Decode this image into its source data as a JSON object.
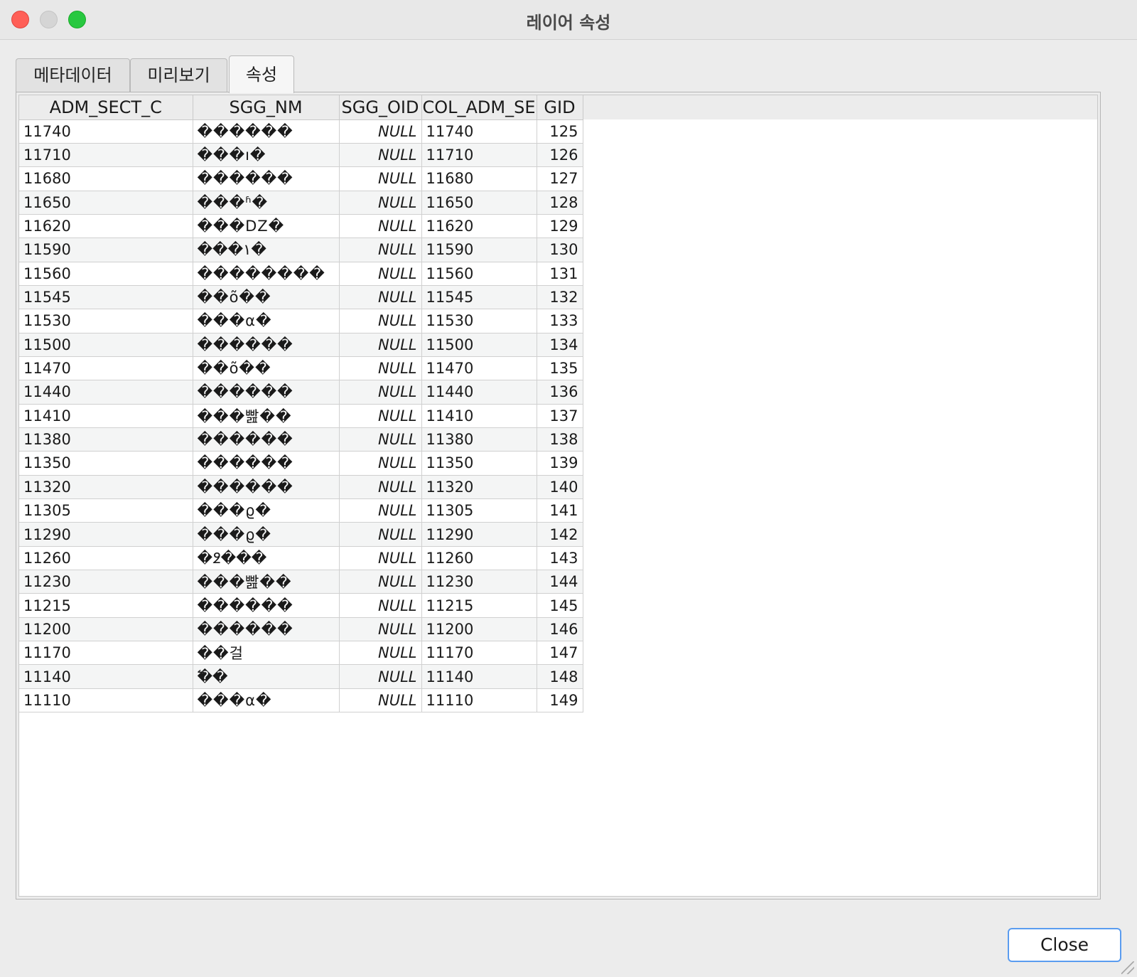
{
  "window": {
    "title": "레이어 속성"
  },
  "tabs": [
    {
      "label": "메타데이터",
      "active": false
    },
    {
      "label": "미리보기",
      "active": false
    },
    {
      "label": "속성",
      "active": true
    }
  ],
  "table": {
    "columns": [
      "ADM_SECT_C",
      "SGG_NM",
      "SGG_OID",
      "COL_ADM_SE",
      "GID"
    ],
    "rows": [
      [
        "11740",
        "������",
        "NULL",
        "11740",
        "125"
      ],
      [
        "11710",
        "���ı�",
        "NULL",
        "11710",
        "126"
      ],
      [
        "11680",
        "������",
        "NULL",
        "11680",
        "127"
      ],
      [
        "11650",
        "���ʱ�",
        "NULL",
        "11650",
        "128"
      ],
      [
        "11620",
        "���DZ�",
        "NULL",
        "11620",
        "129"
      ],
      [
        "11590",
        "���۱�",
        "NULL",
        "11590",
        "130"
      ],
      [
        "11560",
        "��������",
        "NULL",
        "11560",
        "131"
      ],
      [
        "11545",
        "��õ��",
        "NULL",
        "11545",
        "132"
      ],
      [
        "11530",
        "���α�",
        "NULL",
        "11530",
        "133"
      ],
      [
        "11500",
        "������",
        "NULL",
        "11500",
        "134"
      ],
      [
        "11470",
        "��õ��",
        "NULL",
        "11470",
        "135"
      ],
      [
        "11440",
        "������",
        "NULL",
        "11440",
        "136"
      ],
      [
        "11410",
        "���빮��",
        "NULL",
        "11410",
        "137"
      ],
      [
        "11380",
        "������",
        "NULL",
        "11380",
        "138"
      ],
      [
        "11350",
        "������",
        "NULL",
        "11350",
        "139"
      ],
      [
        "11320",
        "������",
        "NULL",
        "11320",
        "140"
      ],
      [
        "11305",
        "���ϱ�",
        "NULL",
        "11305",
        "141"
      ],
      [
        "11290",
        "���ϱ�",
        "NULL",
        "11290",
        "142"
      ],
      [
        "11260",
        "�߶���",
        "NULL",
        "11260",
        "143"
      ],
      [
        "11230",
        "���빮��",
        "NULL",
        "11230",
        "144"
      ],
      [
        "11215",
        "������",
        "NULL",
        "11215",
        "145"
      ],
      [
        "11200",
        "������",
        "NULL",
        "11200",
        "146"
      ],
      [
        "11170",
        "��걸",
        "NULL",
        "11170",
        "147"
      ],
      [
        "11140",
        "�߱�",
        "NULL",
        "11140",
        "148"
      ],
      [
        "11110",
        "���α�",
        "NULL",
        "11110",
        "149"
      ]
    ]
  },
  "buttons": {
    "close_label": "Close"
  }
}
